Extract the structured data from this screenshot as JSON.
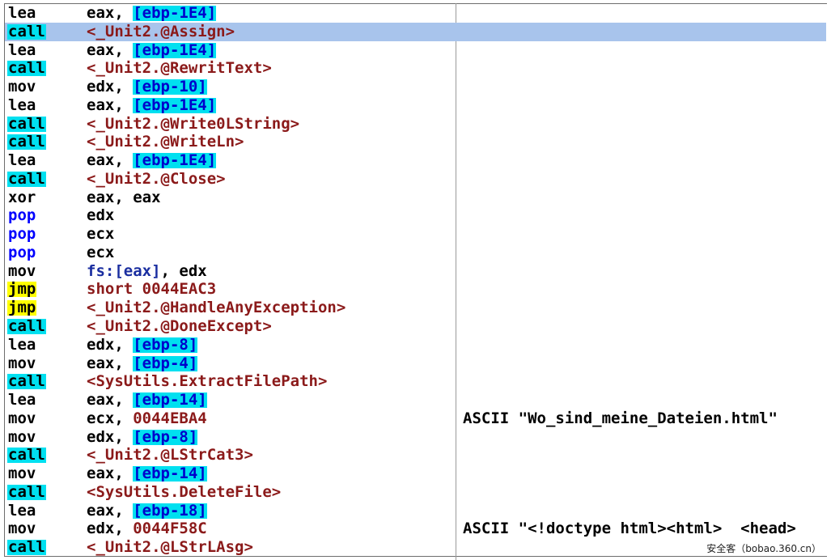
{
  "watermark": "安全客（bobao.360.cn）",
  "rows": [
    {
      "mnemonic": "lea",
      "kind": "plain",
      "operands": [
        {
          "t": "eax, ",
          "c": "reg"
        },
        {
          "t": "[ebp-1E4]",
          "c": "mem"
        }
      ],
      "comment": ""
    },
    {
      "mnemonic": "call",
      "kind": "call",
      "selected": true,
      "operands": [
        {
          "t": "<_Unit2.@Assign>",
          "c": "ref"
        }
      ],
      "comment": ""
    },
    {
      "mnemonic": "lea",
      "kind": "plain",
      "operands": [
        {
          "t": "eax, ",
          "c": "reg"
        },
        {
          "t": "[ebp-1E4]",
          "c": "mem"
        }
      ],
      "comment": ""
    },
    {
      "mnemonic": "call",
      "kind": "call",
      "operands": [
        {
          "t": "<_Unit2.@RewritText>",
          "c": "ref"
        }
      ],
      "comment": ""
    },
    {
      "mnemonic": "mov",
      "kind": "plain",
      "operands": [
        {
          "t": "edx, ",
          "c": "reg"
        },
        {
          "t": "[ebp-10]",
          "c": "mem"
        }
      ],
      "comment": ""
    },
    {
      "mnemonic": "lea",
      "kind": "plain",
      "operands": [
        {
          "t": "eax, ",
          "c": "reg"
        },
        {
          "t": "[ebp-1E4]",
          "c": "mem"
        }
      ],
      "comment": ""
    },
    {
      "mnemonic": "call",
      "kind": "call",
      "operands": [
        {
          "t": "<_Unit2.@Write0LString>",
          "c": "ref"
        }
      ],
      "comment": ""
    },
    {
      "mnemonic": "call",
      "kind": "call",
      "operands": [
        {
          "t": "<_Unit2.@WriteLn>",
          "c": "ref"
        }
      ],
      "comment": ""
    },
    {
      "mnemonic": "lea",
      "kind": "plain",
      "operands": [
        {
          "t": "eax, ",
          "c": "reg"
        },
        {
          "t": "[ebp-1E4]",
          "c": "mem"
        }
      ],
      "comment": ""
    },
    {
      "mnemonic": "call",
      "kind": "call",
      "operands": [
        {
          "t": "<_Unit2.@Close>",
          "c": "ref"
        }
      ],
      "comment": ""
    },
    {
      "mnemonic": "xor",
      "kind": "plain",
      "operands": [
        {
          "t": "eax, eax",
          "c": "reg"
        }
      ],
      "comment": ""
    },
    {
      "mnemonic": "pop",
      "kind": "pop",
      "operands": [
        {
          "t": "edx",
          "c": "reg"
        }
      ],
      "comment": ""
    },
    {
      "mnemonic": "pop",
      "kind": "pop",
      "operands": [
        {
          "t": "ecx",
          "c": "reg"
        }
      ],
      "comment": ""
    },
    {
      "mnemonic": "pop",
      "kind": "pop",
      "operands": [
        {
          "t": "ecx",
          "c": "reg"
        }
      ],
      "comment": ""
    },
    {
      "mnemonic": "mov",
      "kind": "plain",
      "operands": [
        {
          "t": "fs:[eax]",
          "c": "seg"
        },
        {
          "t": ", edx",
          "c": "reg"
        }
      ],
      "comment": ""
    },
    {
      "mnemonic": "jmp",
      "kind": "jmp",
      "operands": [
        {
          "t": "short 0044EAC3",
          "c": "const"
        }
      ],
      "comment": ""
    },
    {
      "mnemonic": "jmp",
      "kind": "jmp",
      "operands": [
        {
          "t": "<_Unit2.@HandleAnyException>",
          "c": "ref"
        }
      ],
      "comment": ""
    },
    {
      "mnemonic": "call",
      "kind": "call",
      "operands": [
        {
          "t": "<_Unit2.@DoneExcept>",
          "c": "ref"
        }
      ],
      "comment": ""
    },
    {
      "mnemonic": "lea",
      "kind": "plain",
      "operands": [
        {
          "t": "edx, ",
          "c": "reg"
        },
        {
          "t": "[ebp-8]",
          "c": "mem"
        }
      ],
      "comment": ""
    },
    {
      "mnemonic": "mov",
      "kind": "plain",
      "operands": [
        {
          "t": "eax, ",
          "c": "reg"
        },
        {
          "t": "[ebp-4]",
          "c": "mem"
        }
      ],
      "comment": ""
    },
    {
      "mnemonic": "call",
      "kind": "call",
      "operands": [
        {
          "t": "<SysUtils.ExtractFilePath>",
          "c": "ref"
        }
      ],
      "comment": ""
    },
    {
      "mnemonic": "lea",
      "kind": "plain",
      "operands": [
        {
          "t": "eax, ",
          "c": "reg"
        },
        {
          "t": "[ebp-14]",
          "c": "mem"
        }
      ],
      "comment": ""
    },
    {
      "mnemonic": "mov",
      "kind": "plain",
      "operands": [
        {
          "t": "ecx, ",
          "c": "reg"
        },
        {
          "t": "0044EBA4",
          "c": "const"
        }
      ],
      "comment": "ASCII \"Wo_sind_meine_Dateien.html\""
    },
    {
      "mnemonic": "mov",
      "kind": "plain",
      "operands": [
        {
          "t": "edx, ",
          "c": "reg"
        },
        {
          "t": "[ebp-8]",
          "c": "mem"
        }
      ],
      "comment": ""
    },
    {
      "mnemonic": "call",
      "kind": "call",
      "operands": [
        {
          "t": "<_Unit2.@LStrCat3>",
          "c": "ref"
        }
      ],
      "comment": ""
    },
    {
      "mnemonic": "mov",
      "kind": "plain",
      "operands": [
        {
          "t": "eax, ",
          "c": "reg"
        },
        {
          "t": "[ebp-14]",
          "c": "mem"
        }
      ],
      "comment": ""
    },
    {
      "mnemonic": "call",
      "kind": "call",
      "operands": [
        {
          "t": "<SysUtils.DeleteFile>",
          "c": "ref"
        }
      ],
      "comment": ""
    },
    {
      "mnemonic": "lea",
      "kind": "plain",
      "operands": [
        {
          "t": "eax, ",
          "c": "reg"
        },
        {
          "t": "[ebp-18]",
          "c": "mem"
        }
      ],
      "comment": ""
    },
    {
      "mnemonic": "mov",
      "kind": "plain",
      "operands": [
        {
          "t": "edx, ",
          "c": "reg"
        },
        {
          "t": "0044F58C",
          "c": "const"
        }
      ],
      "comment": "ASCII \"<!doctype html><html>  <head>"
    },
    {
      "mnemonic": "call",
      "kind": "call",
      "operands": [
        {
          "t": "<_Unit2.@LStrLAsg>",
          "c": "ref"
        }
      ],
      "comment": ""
    }
  ]
}
